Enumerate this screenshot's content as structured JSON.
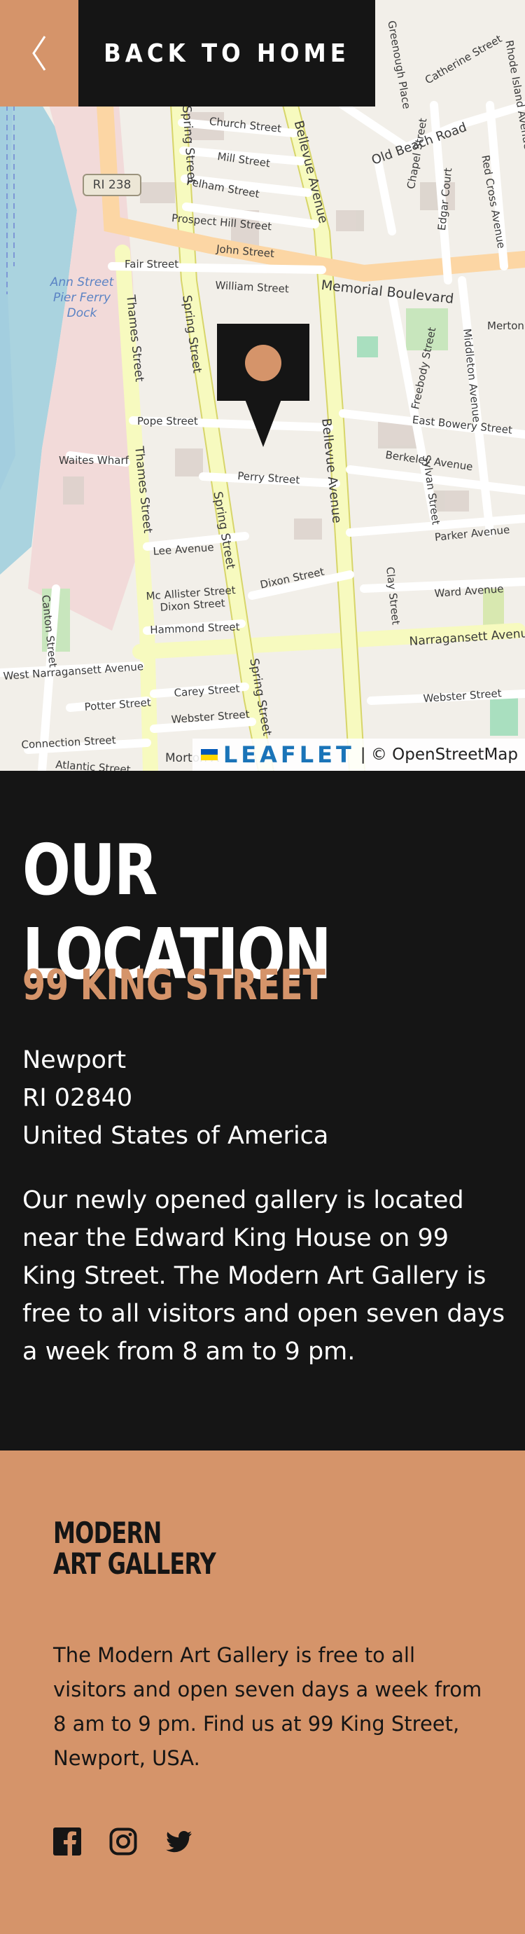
{
  "nav": {
    "back_label": "BACK TO HOME",
    "back_icon": "chevron-left-icon"
  },
  "map": {
    "route_shield": "RI 238",
    "ferry_label": "Ann Street Pier Ferry Dock",
    "streets": {
      "church": "Church Street",
      "mill": "Mill Street",
      "pelham": "Pelham Street",
      "prospect": "Prospect Hill Street",
      "john": "John Street",
      "fair": "Fair Street",
      "william": "William Street",
      "memorial": "Memorial Boulevard",
      "old_beach": "Old Beach Road",
      "greenough": "Greenough Place",
      "catherine": "Catherine Street",
      "rhode_island": "Rhode Island Avenue",
      "red_cross": "Red Cross Avenue",
      "chapel": "Chapel Street",
      "edgar": "Edgar Court",
      "freebody": "Freebody Street",
      "middleton": "Middleton Avenue",
      "merton": "Merton",
      "east_bowery": "East Bowery Street",
      "berkeley": "Berkeley Avenue",
      "sylvan": "Sylvan Street",
      "parker": "Parker Avenue",
      "pope": "Pope Street",
      "waites": "Waites Wharf",
      "perry": "Perry Street",
      "lee": "Lee Avenue",
      "dixon": "Dixon Street",
      "mcallister": "Mc Allister Street",
      "dixon2": "Dixon Street",
      "hammond": "Hammond Street",
      "clay": "Clay Street",
      "ward": "Ward Avenue",
      "narragansett": "Narragansett Avenue",
      "west_narragansett": "West Narragansett Avenue",
      "carey": "Carey Street",
      "potter": "Potter Street",
      "webster": "Webster Street",
      "webster2": "Webster Street",
      "connection": "Connection Street",
      "atlantic": "Atlantic Street",
      "morton": "Morton A",
      "thames": "Thames Street",
      "spring": "Spring Street",
      "bellevue": "Bellevue Avenue",
      "canton": "Canton Street"
    },
    "marker_icon": "map-pin-icon",
    "attribution_brand": "LEAFLET",
    "attribution_text": "| © OpenStreetMap"
  },
  "location": {
    "title": "OUR LOCATION",
    "street": "99 KING STREET",
    "address_lines": [
      "Newport",
      "RI 02840",
      "United States of America"
    ],
    "description": "Our newly opened gallery is located near the Edward King House on 99 King Street. The Modern Art Gallery is free to all visitors and open seven days a week from 8 am to 9 pm."
  },
  "footer": {
    "logo_line1": "MODERN",
    "logo_line2": "ART GALLERY",
    "text": "The Modern Art Gallery is free to all visitors and open seven days a week from 8 am to 9 pm. Find us at 99 King Street, Newport, USA.",
    "socials": [
      "facebook-icon",
      "instagram-icon",
      "twitter-icon"
    ]
  },
  "colors": {
    "accent": "#D5946A",
    "dark": "#151515",
    "white": "#FFFFFF"
  }
}
